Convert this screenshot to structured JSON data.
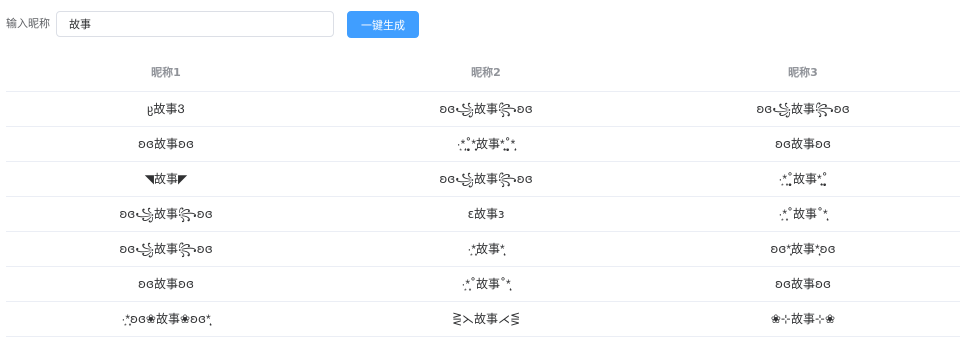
{
  "form": {
    "label": "输入昵称",
    "input_value": "故事",
    "button_label": "一键生成"
  },
  "table": {
    "headers": [
      "昵称1",
      "昵称2",
      "昵称3"
    ],
    "rows": [
      [
        "ჸ故事Ვ",
        "ʚɞ꧁故事꧂ʚɞ",
        "ʚɞ꧁故事꧂ʚɞ"
      ],
      [
        "ʚɞ故事ʚɞ",
        "·͙*̩̩͙˚̩̥̩̥*̩̩̥͙故事*̩̩̥͙˚̩̥̩̥*̩̩͙",
        "ʚɞ故事ʚɞ"
      ],
      [
        "◥故事◤",
        "ʚɞ꧁故事꧂ʚɞ",
        "·͙*̩̩͙˚̩̥̩̥故事*̩̩̥͙˚̩̥̩̥"
      ],
      [
        "ʚɞ꧁故事꧂ʚɞ",
        "ɛ故事ɜ",
        "·͙*̩̩͙˚故事˚*̩̩͙"
      ],
      [
        "ʚɞ꧁故事꧂ʚɞ",
        "·͙*̩̩͙故事*̩̩͙",
        "ʚɞ*̩̩͙故事*̩̩͙ʚɞ"
      ],
      [
        "ʚɞ故事ʚɞ",
        "·͙*̩̩͙˚故事˚*̩̩͙",
        "ʚɞ故事ʚɞ"
      ],
      [
        "·͙*̩̩͙ʚɞ❀故事❀ʚɞ*̩̩͙",
        "⋛⋋故事⋌⋚",
        "❀⊹故事⊹❀"
      ]
    ]
  }
}
